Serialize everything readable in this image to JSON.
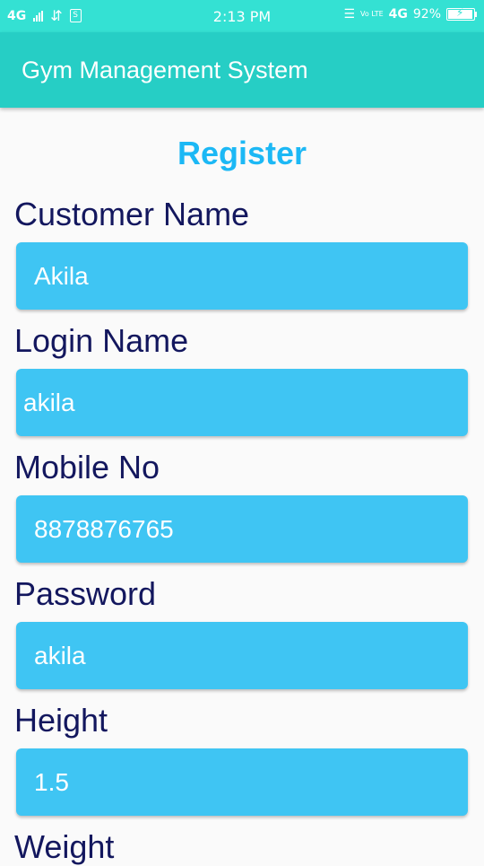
{
  "status_bar": {
    "network": "4G",
    "time": "2:13 PM",
    "volte": "Vo LTE",
    "network_right": "4G",
    "battery": "92%"
  },
  "app_bar": {
    "title": "Gym Management System"
  },
  "form": {
    "heading": "Register",
    "fields": [
      {
        "label": "Customer Name",
        "value": "Akila"
      },
      {
        "label": "Login Name",
        "value": "akila"
      },
      {
        "label": "Mobile No",
        "value": "8878876765"
      },
      {
        "label": "Password",
        "value": "akila"
      },
      {
        "label": "Height",
        "value": "1.5"
      },
      {
        "label": "Weight",
        "value": ""
      }
    ]
  },
  "colors": {
    "status_bar": "#34e1d3",
    "app_bar": "#26cec5",
    "heading": "#1cb8f5",
    "field_bg": "#3fc5f3",
    "label": "#13175e"
  }
}
